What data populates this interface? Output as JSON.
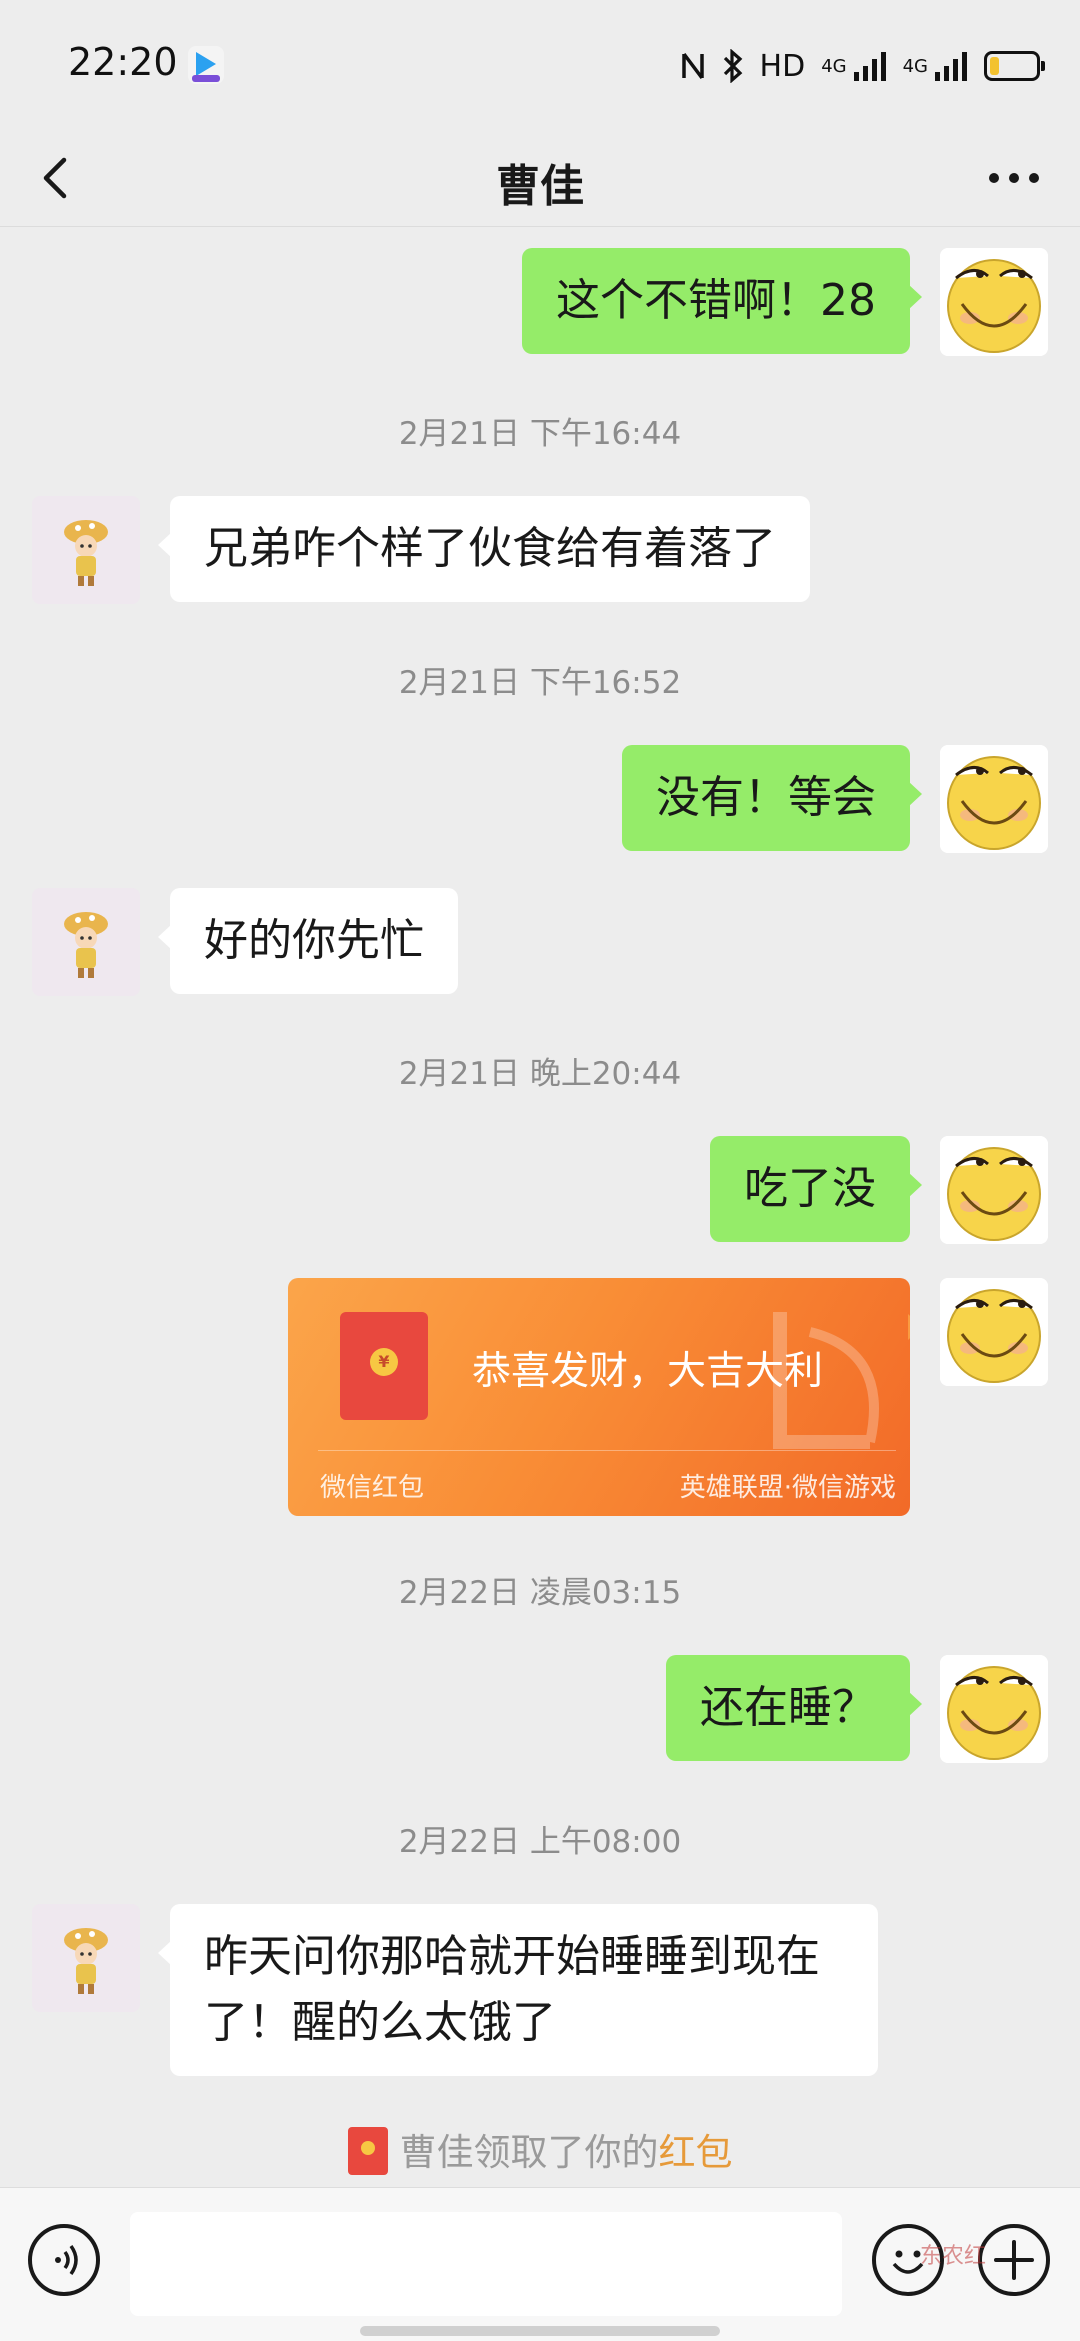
{
  "status_bar": {
    "time": "22:20",
    "hd_label": "HD",
    "network_1": "4G",
    "network_2": "4G"
  },
  "header": {
    "title": "曹佳"
  },
  "messages": [
    {
      "type": "text",
      "side": "out",
      "text": "这个不错啊！28"
    },
    {
      "type": "timestamp",
      "text": "2月21日 下午16:44"
    },
    {
      "type": "text",
      "side": "in",
      "text": "兄弟咋个样了伙食给有着落了"
    },
    {
      "type": "timestamp",
      "text": "2月21日 下午16:52"
    },
    {
      "type": "text",
      "side": "out",
      "text": "没有！等会"
    },
    {
      "type": "text",
      "side": "in",
      "text": "好的你先忙"
    },
    {
      "type": "timestamp",
      "text": "2月21日 晚上20:44"
    },
    {
      "type": "text",
      "side": "out",
      "text": "吃了没"
    },
    {
      "type": "red_packet",
      "side": "out",
      "greeting": "恭喜发财，大吉大利",
      "footer_left": "微信红包",
      "footer_right": "英雄联盟·微信游戏"
    },
    {
      "type": "timestamp",
      "text": "2月22日 凌晨03:15"
    },
    {
      "type": "text",
      "side": "out",
      "text": "还在睡？"
    },
    {
      "type": "timestamp",
      "text": "2月22日 上午08:00"
    },
    {
      "type": "text",
      "side": "in",
      "text": "昨天问你那哈就开始睡睡到现在了！醒的么太饿了"
    }
  ],
  "system_note": {
    "prefix": "曹佳领取了你的",
    "link": "红包"
  },
  "watermark": {
    "text": "东农红"
  },
  "colors": {
    "outgoing_bubble": "#95ec69",
    "incoming_bubble": "#ffffff",
    "red_packet": "#f98d36",
    "background": "#ededed"
  }
}
